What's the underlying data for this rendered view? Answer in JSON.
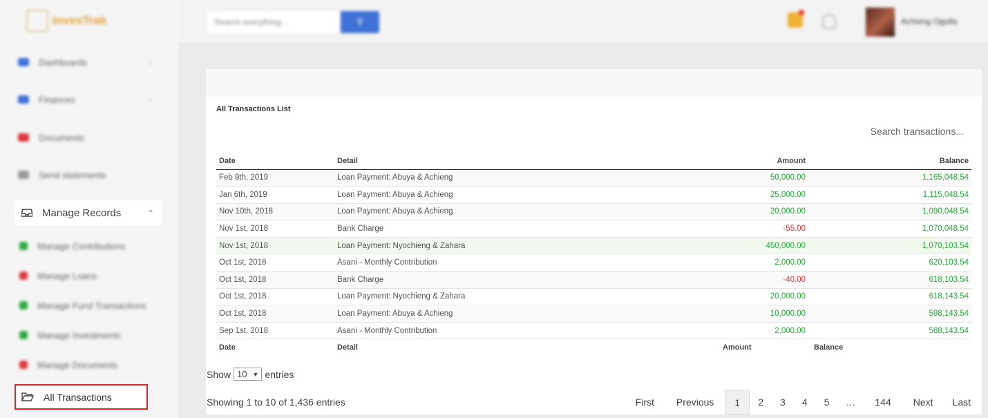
{
  "app": {
    "logo_text": "InvesTrak"
  },
  "topbar": {
    "search_placeholder": "Search everything...",
    "search_button_icon": "search-icon",
    "user_name": "Achieng Ogolla"
  },
  "sidebar": {
    "items": [
      {
        "label": "Dashboards",
        "color": "#3f72d8",
        "chevron": "⌄"
      },
      {
        "label": "Finances",
        "color": "#3f72d8",
        "chevron": "⌄"
      },
      {
        "label": "Documents",
        "color": "#e0383e",
        "chevron": ""
      },
      {
        "label": "Send statements",
        "color": "#999999",
        "chevron": ""
      }
    ],
    "manage_records": {
      "label": "Manage Records",
      "chevron": "⌃"
    },
    "sub_items": [
      {
        "label": "Manage Contributions",
        "color": "#2bab3d"
      },
      {
        "label": "Manage Loans",
        "color": "#e0383e"
      },
      {
        "label": "Manage Fund Transactions",
        "color": "#2bab3d"
      },
      {
        "label": "Manage Investments",
        "color": "#2bab3d"
      },
      {
        "label": "Manage Documents",
        "color": "#e0383e"
      }
    ],
    "active_item": {
      "label": "All Transactions"
    }
  },
  "card": {
    "title": "All Transactions List",
    "search_placeholder": "Search transactions...",
    "columns": [
      "Date",
      "Detail",
      "Amount",
      "Balance"
    ],
    "rows": [
      {
        "date": "Feb 9th, 2019",
        "detail": "Loan Payment: Abuya & Achieng",
        "amount": "50,000.00",
        "balance": "1,165,048.54",
        "amount_sign": "pos"
      },
      {
        "date": "Jan 6th, 2019",
        "detail": "Loan Payment: Abuya & Achieng",
        "amount": "25,000.00",
        "balance": "1,115,048.54",
        "amount_sign": "pos"
      },
      {
        "date": "Nov 10th, 2018",
        "detail": "Loan Payment: Abuya & Achieng",
        "amount": "20,000.00",
        "balance": "1,090,048.54",
        "amount_sign": "pos"
      },
      {
        "date": "Nov 1st, 2018",
        "detail": "Bank Charge",
        "amount": "-55.00",
        "balance": "1,070,048.54",
        "amount_sign": "neg"
      },
      {
        "date": "Nov 1st, 2018",
        "detail": "Loan Payment: Nyochieng & Zahara",
        "amount": "450,000.00",
        "balance": "1,070,103.54",
        "amount_sign": "pos"
      },
      {
        "date": "Oct 1st, 2018",
        "detail": "Asani - Monthly Contribution",
        "amount": "2,000.00",
        "balance": "620,103.54",
        "amount_sign": "pos"
      },
      {
        "date": "Oct 1st, 2018",
        "detail": "Bank Charge",
        "amount": "-40.00",
        "balance": "618,103.54",
        "amount_sign": "neg"
      },
      {
        "date": "Oct 1st, 2018",
        "detail": "Loan Payment: Nyochieng & Zahara",
        "amount": "20,000.00",
        "balance": "618,143.54",
        "amount_sign": "pos"
      },
      {
        "date": "Oct 1st, 2018",
        "detail": "Loan Payment: Abuya & Achieng",
        "amount": "10,000.00",
        "balance": "598,143.54",
        "amount_sign": "pos"
      },
      {
        "date": "Sep 1st, 2018",
        "detail": "Asani - Monthly Contribution",
        "amount": "2,000.00",
        "balance": "588,143.54",
        "amount_sign": "pos"
      }
    ],
    "footer_columns": [
      "Date",
      "Detail",
      "Amount",
      "Balance"
    ],
    "show_label": "Show",
    "entries_value": "10",
    "entries_label": "entries",
    "showing_text": "Showing 1 to 10 of 1,436 entries",
    "pagination": {
      "first": "First",
      "previous": "Previous",
      "pages": [
        "1",
        "2",
        "3",
        "4",
        "5"
      ],
      "ellipsis": "…",
      "last_page": "144",
      "next": "Next",
      "last": "Last",
      "current": "1"
    }
  },
  "colors": {
    "accent": "#3f72d8",
    "positive": "#2bab3d",
    "negative": "#e0383e",
    "highlight": "#d9262a"
  }
}
